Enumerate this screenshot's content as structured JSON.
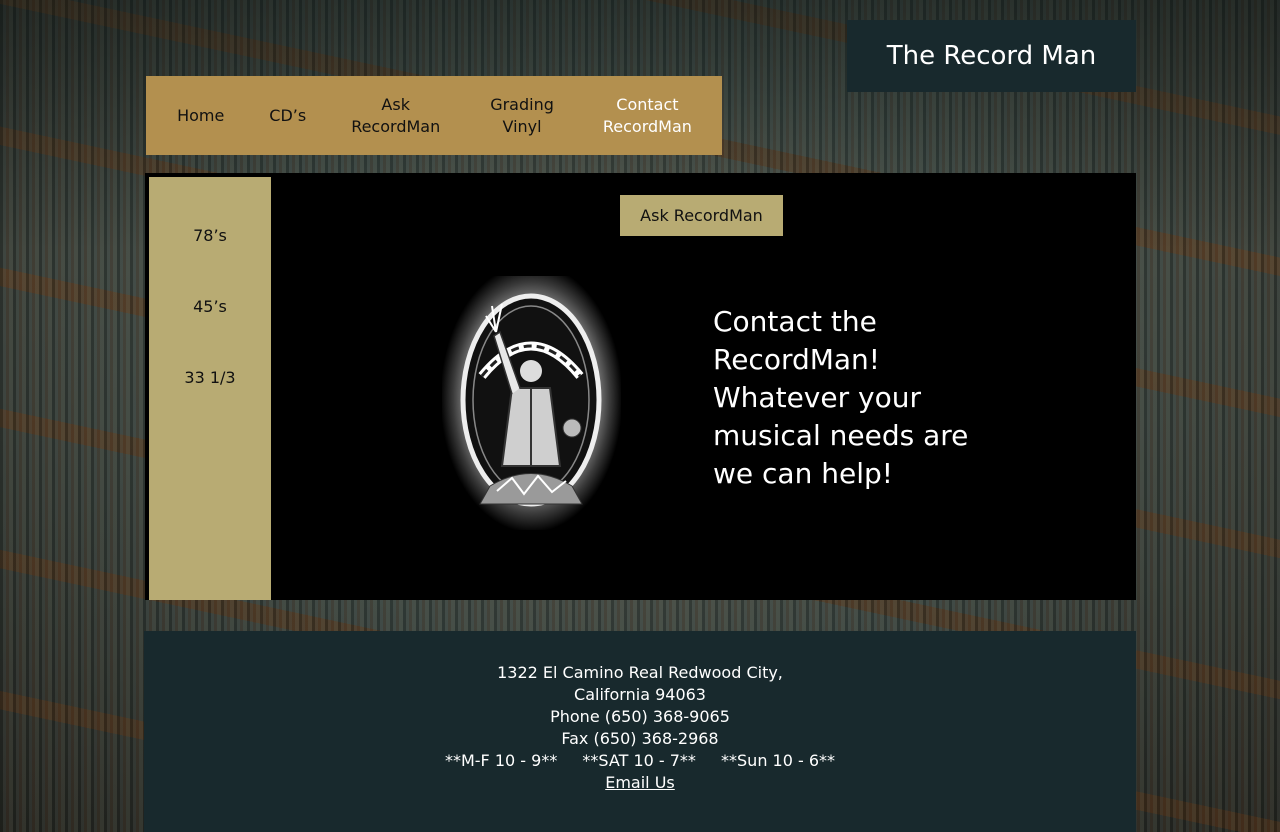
{
  "site": {
    "title": "The Record Man"
  },
  "nav": {
    "items": [
      {
        "label": "Home"
      },
      {
        "label": "CD’s"
      },
      {
        "label": "Ask\nRecordMan"
      },
      {
        "label": "Grading\nVinyl"
      },
      {
        "label": "Contact\nRecordMan"
      }
    ]
  },
  "sidebar": {
    "items": [
      {
        "label": "78’s"
      },
      {
        "label": "45’s"
      },
      {
        "label": "33 1/3"
      }
    ]
  },
  "main": {
    "ask_button": "Ask RecordMan",
    "logo_icon": "recordman-logo",
    "tagline": "Contact the RecordMan! Whatever your musical needs are we can help!"
  },
  "footer": {
    "address": "1322 El Camino Real Redwood City, California 94063",
    "phone": "Phone (650) 368-9065",
    "fax": "Fax (650) 368-2968",
    "hours": [
      "**M-F  10 - 9**",
      "**SAT 10 - 7**",
      "**Sun 10 - 6**"
    ],
    "email_link": "Email Us"
  },
  "colors": {
    "nav_bg": "#b3904f",
    "sidebar_bg": "#b8ab73",
    "panel_bg": "#18292d",
    "content_bg": "#000000"
  }
}
